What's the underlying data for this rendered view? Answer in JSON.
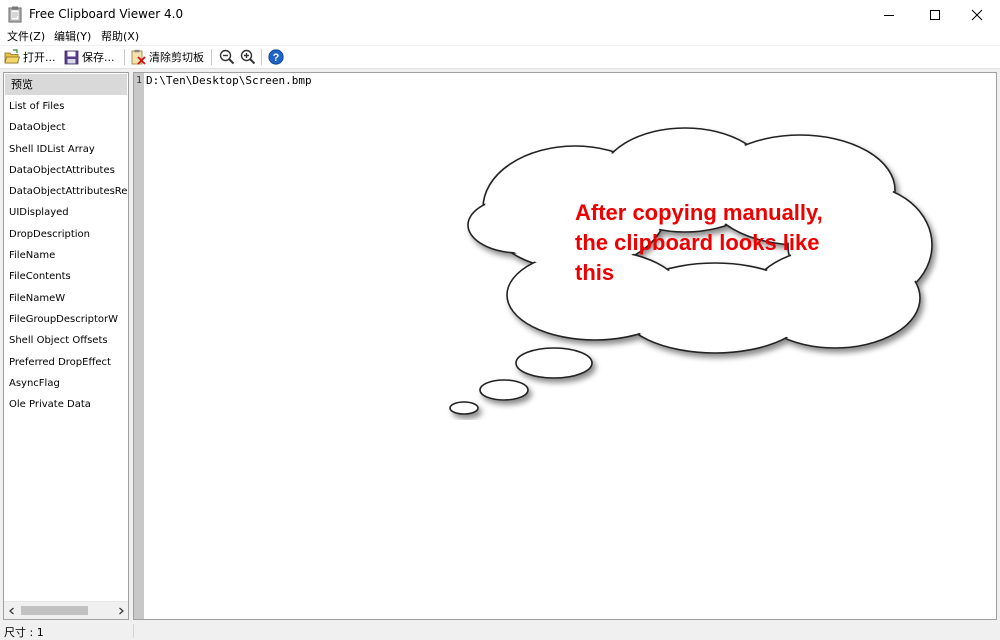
{
  "window": {
    "title": "Free Clipboard Viewer 4.0"
  },
  "menu": [
    "文件(Z)",
    "编辑(Y)",
    "帮助(X)"
  ],
  "toolbar": {
    "open_label": "打开...",
    "save_label": "保存...",
    "clear_label": "清除剪切板"
  },
  "formats": [
    "预览",
    "List of Files",
    "DataObject",
    "Shell IDList Array",
    "DataObjectAttributes",
    "DataObjectAttributesRequiringElevation",
    "UIDisplayed",
    "DropDescription",
    "FileName",
    "FileContents",
    "FileNameW",
    "FileGroupDescriptorW",
    "Shell Object Offsets",
    "Preferred DropEffect",
    "AsyncFlag",
    "Ole Private Data"
  ],
  "editor": {
    "line_number": "1",
    "content": "D:\\Ten\\Desktop\\Screen.bmp"
  },
  "callout": {
    "line1": "After copying manually,",
    "line2": "the clipboard looks like",
    "line3": "this",
    "color": "#ee0000"
  },
  "status": {
    "size": "尺寸 : 1"
  }
}
